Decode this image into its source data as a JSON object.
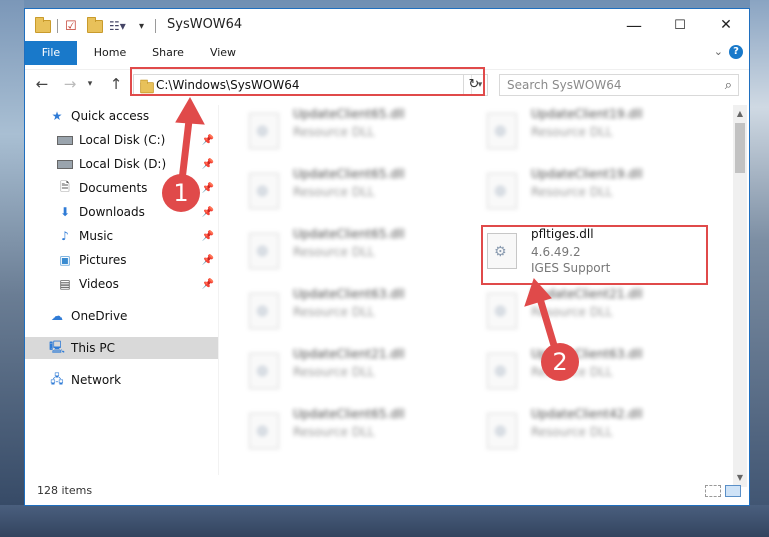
{
  "window": {
    "title": "SysWOW64",
    "controls": {
      "minimize": "—",
      "maximize": "☐",
      "close": "✕"
    }
  },
  "ribbon": {
    "tabs": [
      "File",
      "Home",
      "Share",
      "View"
    ],
    "help": "?"
  },
  "address_bar": {
    "path": "C:\\Windows\\SysWOW64",
    "search_placeholder": "Search SysWOW64"
  },
  "sidebar": {
    "items": [
      {
        "label": "Quick access",
        "icon": "star-icon",
        "pinned": false
      },
      {
        "label": "Local Disk (C:)",
        "icon": "drive-icon",
        "pinned": true
      },
      {
        "label": "Local Disk (D:)",
        "icon": "drive-icon",
        "pinned": true
      },
      {
        "label": "Documents",
        "icon": "documents-icon",
        "pinned": true
      },
      {
        "label": "Downloads",
        "icon": "download-icon",
        "pinned": true
      },
      {
        "label": "Music",
        "icon": "music-icon",
        "pinned": true
      },
      {
        "label": "Pictures",
        "icon": "pictures-icon",
        "pinned": true
      },
      {
        "label": "Videos",
        "icon": "videos-icon",
        "pinned": true
      },
      {
        "label": "OneDrive",
        "icon": "cloud-icon",
        "pinned": false
      },
      {
        "label": "This PC",
        "icon": "computer-icon",
        "pinned": false,
        "selected": true
      },
      {
        "label": "Network",
        "icon": "network-icon",
        "pinned": false
      }
    ]
  },
  "files": {
    "left_column": [
      {
        "name": "UpdateClient65.dll",
        "desc": "Resource DLL"
      },
      {
        "name": "UpdateClient65.dll",
        "desc": "Resource DLL"
      },
      {
        "name": "UpdateClient65.dll",
        "desc": "Resource DLL"
      },
      {
        "name": "UpdateClient63.dll",
        "desc": "Resource DLL"
      },
      {
        "name": "UpdateClient21.dll",
        "desc": "Resource DLL"
      },
      {
        "name": "UpdateClient65.dll",
        "desc": "Resource DLL"
      }
    ],
    "right_column": [
      {
        "name": "UpdateClient19.dll",
        "desc": "Resource DLL"
      },
      {
        "name": "UpdateClient19.dll",
        "desc": "Resource DLL"
      },
      {
        "name": "pfltiges.dll",
        "version": "4.6.49.2",
        "desc": "IGES Support",
        "highlighted": true
      },
      {
        "name": "UpdateClient21.dll",
        "desc": "Resource DLL"
      },
      {
        "name": "UpdateClient63.dll",
        "desc": "Resource DLL"
      },
      {
        "name": "UpdateClient42.dll",
        "desc": "Resource DLL"
      }
    ]
  },
  "status_bar": {
    "item_count": "128 items"
  },
  "callouts": {
    "one": "1",
    "two": "2"
  },
  "colors": {
    "accent": "#1979ca",
    "highlight": "#e04a4a"
  }
}
